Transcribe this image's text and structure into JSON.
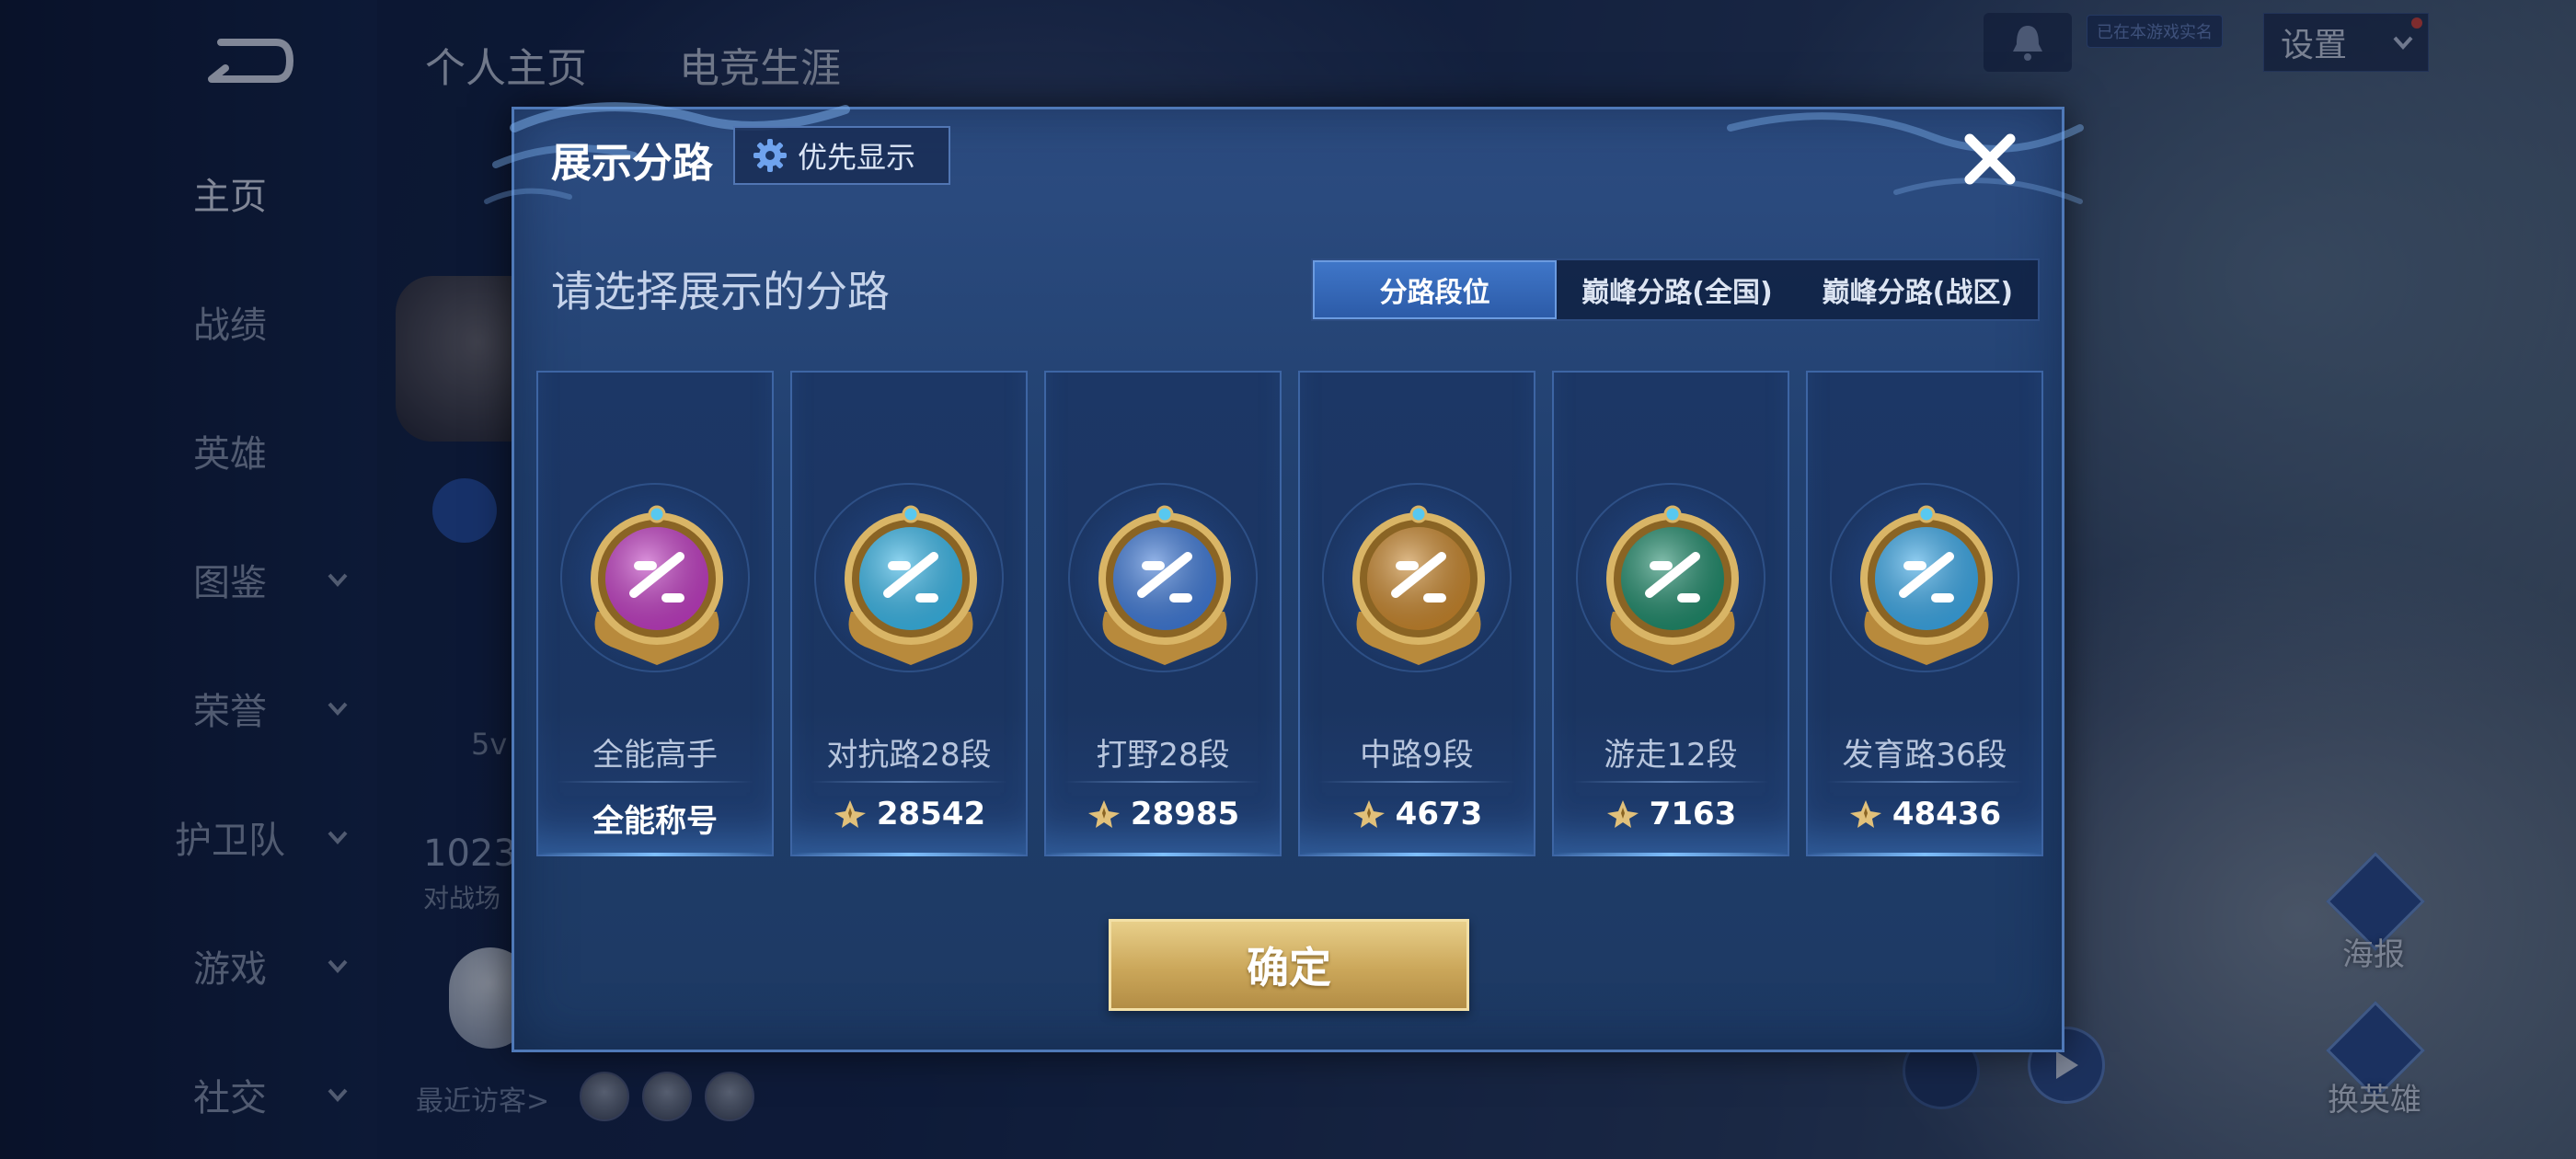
{
  "background": {
    "nav": {
      "back_icon": "back-arrow-icon",
      "items": [
        {
          "label": "主页",
          "active": true,
          "has_chevron": false
        },
        {
          "label": "战绩",
          "active": false,
          "has_chevron": false
        },
        {
          "label": "英雄",
          "active": false,
          "has_chevron": false
        },
        {
          "label": "图鉴",
          "active": false,
          "has_chevron": true
        },
        {
          "label": "荣誉",
          "active": false,
          "has_chevron": true
        },
        {
          "label": "护卫队",
          "active": false,
          "has_chevron": true
        },
        {
          "label": "游戏",
          "active": false,
          "has_chevron": true
        },
        {
          "label": "社交",
          "active": false,
          "has_chevron": true
        }
      ]
    },
    "top_tabs": [
      "个人主页",
      "电竞生涯"
    ],
    "settings_label": "设置",
    "realname_tag": "已在本游戏实名",
    "profile": {
      "number": "1023",
      "sub": "对战场",
      "mode": "5v"
    },
    "recent_visitors_label": "最近访客>",
    "side_buttons": {
      "poster": "海报",
      "change_hero": "换英雄"
    }
  },
  "dialog": {
    "title": "展示分路",
    "priority_label": "优先显示",
    "close_icon": "close-x-icon",
    "section_title": "请选择展示的分路",
    "tabs": [
      {
        "label": "分路段位",
        "active": true
      },
      {
        "label": "巅峰分路(全国)",
        "active": false
      },
      {
        "label": "巅峰分路(战区)",
        "active": false
      }
    ],
    "cards": [
      {
        "name": "全能高手",
        "value": "全能称号",
        "has_value_icon": false,
        "emblem": "all-round-emblem-icon",
        "color": "#c03cc2"
      },
      {
        "name": "对抗路28段",
        "value": "28542",
        "has_value_icon": true,
        "emblem": "clash-lane-emblem-icon",
        "color": "#38b6e8"
      },
      {
        "name": "打野28段",
        "value": "28985",
        "has_value_icon": true,
        "emblem": "jungle-emblem-icon",
        "color": "#3f7ad8"
      },
      {
        "name": "中路9段",
        "value": "4673",
        "has_value_icon": true,
        "emblem": "mid-lane-emblem-icon",
        "color": "#c8862c"
      },
      {
        "name": "游走12段",
        "value": "7163",
        "has_value_icon": true,
        "emblem": "roam-emblem-icon",
        "color": "#1e8a6a"
      },
      {
        "name": "发育路36段",
        "value": "48436",
        "has_value_icon": true,
        "emblem": "farm-lane-emblem-icon",
        "color": "#3aa8e8"
      }
    ],
    "confirm_label": "确定"
  }
}
